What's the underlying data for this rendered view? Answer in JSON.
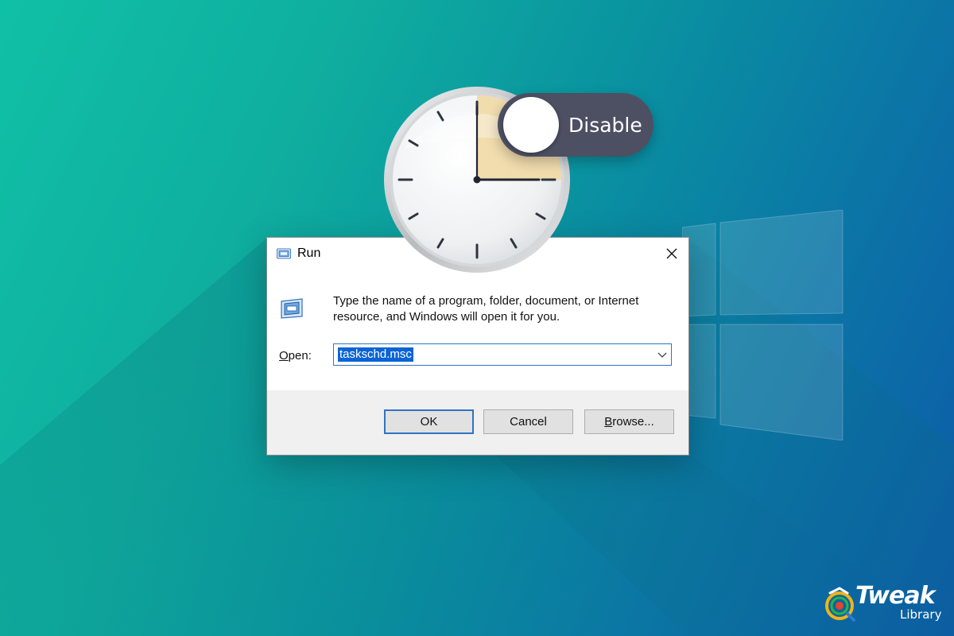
{
  "colors": {
    "background_start": "#10c0a6",
    "background_end": "#0d5aa8",
    "dialog_accent": "#2f73c6",
    "selection": "#0a64d6",
    "toggle_track": "#4d5063",
    "clock_highlight": "#f1d9a5"
  },
  "toggle": {
    "label": "Disable",
    "state": "off"
  },
  "run_dialog": {
    "title": "Run",
    "title_icon": "run-app-icon",
    "close_icon": "close-icon",
    "description": "Type the name of a program, folder, document, or Internet resource, and Windows will open it for you.",
    "open_label_accel": "O",
    "open_label_rest": "pen:",
    "open_value": "taskschd.msc",
    "dropdown_icon": "chevron-down-icon",
    "buttons": {
      "ok": "OK",
      "cancel": "Cancel",
      "browse_accel": "B",
      "browse_rest": "rowse..."
    }
  },
  "clock": {
    "icon": "clock-icon"
  },
  "brand": {
    "name": "Tweak",
    "sub": "Library",
    "icon": "tweak-library-logo-icon"
  },
  "wallpaper": {
    "logo_icon": "windows-logo-icon"
  }
}
